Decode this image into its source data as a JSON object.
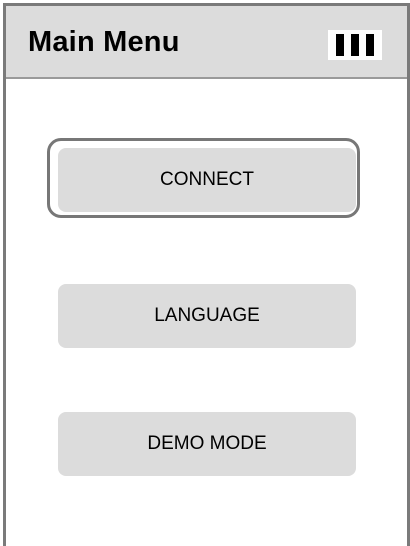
{
  "header": {
    "title": "Main Menu",
    "battery_icon": "battery-level-icon",
    "battery_bars": 3
  },
  "menu": {
    "selected_item": "CONNECT",
    "items": [
      {
        "label": "CONNECT"
      },
      {
        "label": "LANGUAGE"
      },
      {
        "label": "DEMO MODE"
      }
    ]
  },
  "colors": {
    "header_bg": "#dcdcdc",
    "button_bg": "#dcdcdc",
    "frame": "#7a7a7a",
    "focus_ring": "#777777"
  }
}
